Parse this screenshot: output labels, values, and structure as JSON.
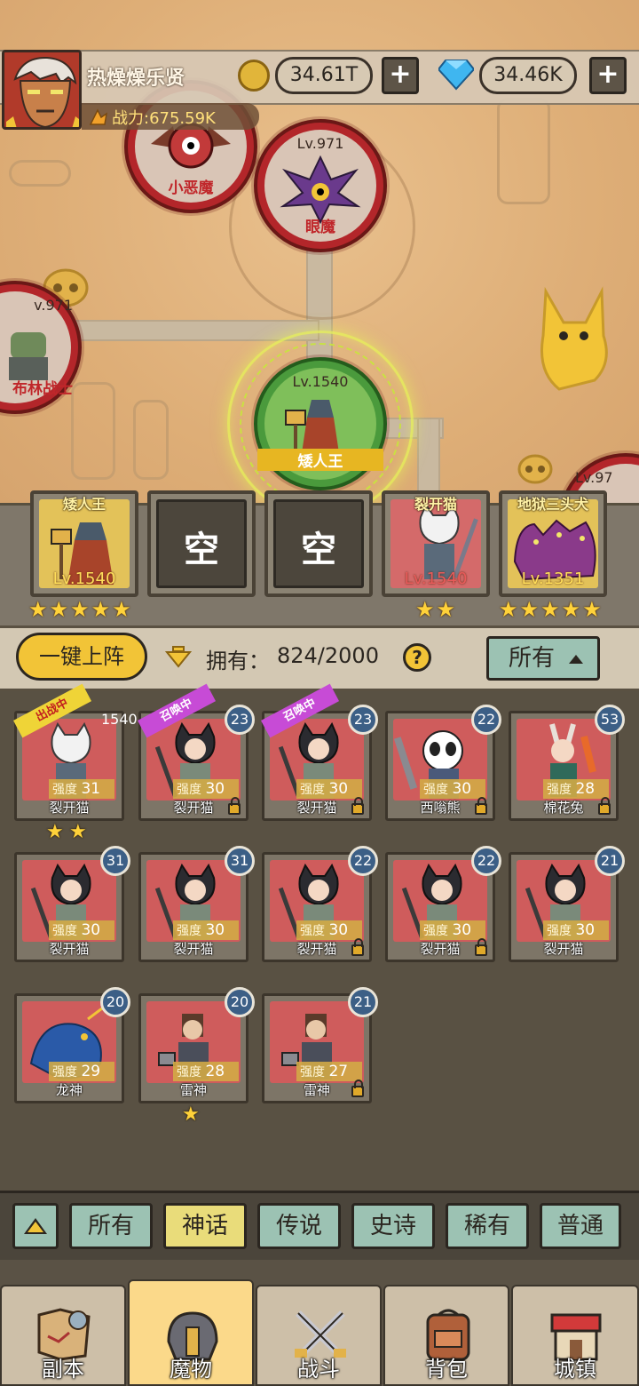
{
  "player": {
    "name": "热燥燥乐贤",
    "power": "战力:675.59K"
  },
  "currency": {
    "coins": "34.61T",
    "gems": "34.46K",
    "add": "+"
  },
  "map_nodes": [
    {
      "lv": "",
      "name": "小恶魔"
    },
    {
      "lv": "Lv.971",
      "name": "眼魔"
    },
    {
      "lv": "v.971",
      "name": "布林战士"
    },
    {
      "lv": "Lv.1540",
      "name": "矮人王"
    },
    {
      "lv": "Lv.97",
      "name": ""
    }
  ],
  "team": [
    {
      "title": "矮人王",
      "lv": "Lv.1540",
      "stars": 5
    },
    {
      "empty": "空"
    },
    {
      "empty": "空"
    },
    {
      "title": "裂开猫",
      "lv": "Lv.1540",
      "stars": 2
    },
    {
      "title": "地狱三头犬",
      "lv": "Lv.1351",
      "stars": 5
    }
  ],
  "toolbar": {
    "one_key": "一键上阵",
    "own_label": "拥有：",
    "own_value": "824/2000",
    "help": "?",
    "filter": "所有"
  },
  "cards": [
    {
      "name": "裂开猫",
      "str_label": "强度",
      "str": "31",
      "lvl": "1540",
      "ribbon": "出战中",
      "stars": 2
    },
    {
      "name": "裂开猫",
      "str_label": "强度",
      "str": "30",
      "lvl": "23",
      "ribbon": "召唤中"
    },
    {
      "name": "裂开猫",
      "str_label": "强度",
      "str": "30",
      "lvl": "23",
      "ribbon": "召唤中"
    },
    {
      "name": "西嗡熊",
      "str_label": "强度",
      "str": "30",
      "lvl": "22"
    },
    {
      "name": "棉花兔",
      "str_label": "强度",
      "str": "28",
      "lvl": "53"
    },
    {
      "name": "裂开猫",
      "str_label": "强度",
      "str": "30",
      "lvl": "31"
    },
    {
      "name": "裂开猫",
      "str_label": "强度",
      "str": "30",
      "lvl": "31"
    },
    {
      "name": "裂开猫",
      "str_label": "强度",
      "str": "30",
      "lvl": "22"
    },
    {
      "name": "裂开猫",
      "str_label": "强度",
      "str": "30",
      "lvl": "22"
    },
    {
      "name": "裂开猫",
      "str_label": "强度",
      "str": "30",
      "lvl": "21"
    },
    {
      "name": "龙神",
      "str_label": "强度",
      "str": "29",
      "lvl": "20"
    },
    {
      "name": "雷神",
      "str_label": "强度",
      "str": "28",
      "lvl": "20",
      "stars": 1
    },
    {
      "name": "雷神",
      "str_label": "强度",
      "str": "27",
      "lvl": "21"
    }
  ],
  "rarity_tabs": [
    "所有",
    "神话",
    "传说",
    "史诗",
    "稀有",
    "普通"
  ],
  "nav": [
    "副本",
    "魔物",
    "战斗",
    "背包",
    "城镇"
  ],
  "colors": {
    "accent": "#f2c437",
    "tab": "#9cc2b3",
    "tab_active": "#e9dc7a",
    "level_badge": "#3c5f86"
  }
}
